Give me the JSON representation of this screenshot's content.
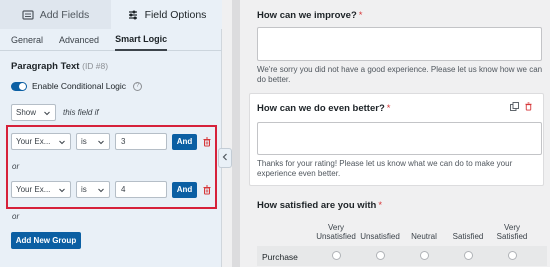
{
  "tabs": {
    "add_fields": "Add Fields",
    "field_options": "Field Options"
  },
  "subtabs": [
    "General",
    "Advanced",
    "Smart Logic"
  ],
  "field": {
    "title": "Paragraph Text",
    "id": "(ID #8)",
    "toggle_label": "Enable Conditional Logic"
  },
  "show_row": {
    "action": "Show",
    "suffix": "this field if"
  },
  "rules": [
    {
      "field": "Your Ex...",
      "operator": "is",
      "value": "3",
      "and_label": "And"
    },
    {
      "field": "Your Ex...",
      "operator": "is",
      "value": "4",
      "and_label": "And"
    }
  ],
  "or_label": "or",
  "add_group_label": "Add New Group",
  "form": {
    "q1": {
      "label": "How can we improve?",
      "req": "*",
      "desc": "We're sorry you did not have a good experience. Please let us know how we can do better."
    },
    "q2": {
      "label": "How can we do even better?",
      "req": "*",
      "desc_line1": "Thanks for your rating! Please let us know what we can do to make your",
      "desc_line2": "experience even better."
    },
    "q3": {
      "label": "How satisfied are you with",
      "req": "*",
      "columns": [
        {
          "line1": "Very",
          "line2": "Unsatisfied"
        },
        {
          "line1": "",
          "line2": "Unsatisfied"
        },
        {
          "line1": "",
          "line2": "Neutral"
        },
        {
          "line1": "",
          "line2": "Satisfied"
        },
        {
          "line1": "Very",
          "line2": "Satisfied"
        }
      ],
      "row_label": "Purchase"
    }
  },
  "colors": {
    "accent": "#0b5fa3",
    "highlight": "#d6213a",
    "required": "#d63638"
  }
}
